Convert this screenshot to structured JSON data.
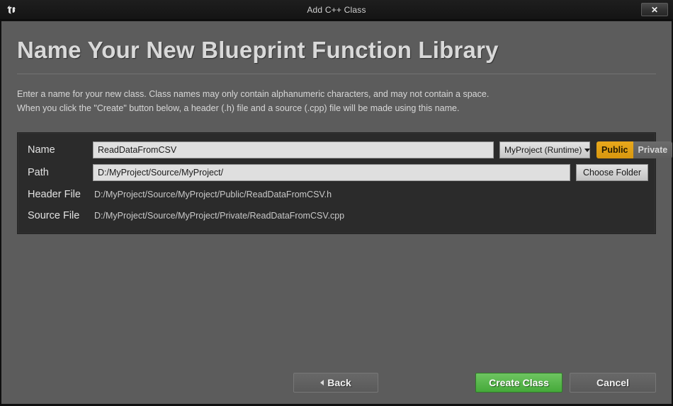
{
  "titlebar": {
    "app_icon": "unreal-engine-logo-icon",
    "title": "Add C++ Class",
    "close_label": "✕"
  },
  "page": {
    "heading": "Name Your New Blueprint Function Library",
    "description_line1": "Enter a name for your new class. Class names may only contain alphanumeric characters, and may not contain a space.",
    "description_line2": "When you click the \"Create\" button below, a header (.h) file and a source (.cpp) file will be made using this name."
  },
  "form": {
    "name": {
      "label": "Name",
      "value": "ReadDataFromCSV",
      "placeholder": "Name"
    },
    "module": {
      "selected": "MyProject (Runtime)",
      "caret_icon": "chevron-down-icon"
    },
    "visibility": {
      "public_label": "Public",
      "private_label": "Private",
      "selected": "Public"
    },
    "path": {
      "label": "Path",
      "value": "D:/MyProject/Source/MyProject/",
      "placeholder": "Path"
    },
    "choose_folder_label": "Choose Folder",
    "header_file": {
      "label": "Header File",
      "value": "D:/MyProject/Source/MyProject/Public/ReadDataFromCSV.h"
    },
    "source_file": {
      "label": "Source File",
      "value": "D:/MyProject/Source/MyProject/Private/ReadDataFromCSV.cpp"
    }
  },
  "footer": {
    "back_label": "Back",
    "back_icon": "chevron-left-icon",
    "create_label": "Create Class",
    "cancel_label": "Cancel"
  },
  "colors": {
    "window_background": "#5c5c5c",
    "titlebar": "#161616",
    "panel": "#2b2b2b",
    "accent_selected": "#e8a81c",
    "create_button": "#4fae41",
    "input_background": "#dfdfdf"
  }
}
